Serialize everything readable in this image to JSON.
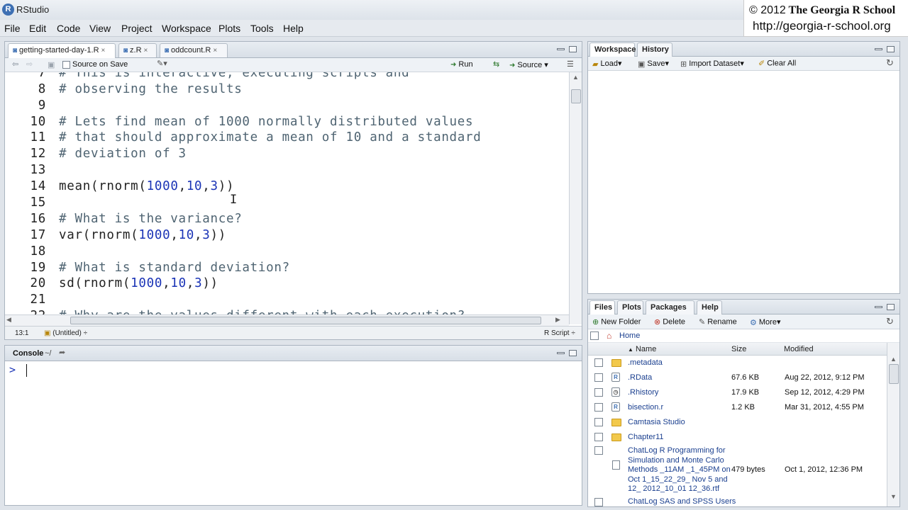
{
  "app": {
    "title": "RStudio",
    "icon_letter": "R"
  },
  "watermark": {
    "line1_copy": "© 2012",
    "line1_name": "The Georgia R School",
    "line2": "http://georgia-r-school.org"
  },
  "menu": [
    "File",
    "Edit",
    "Code",
    "View",
    "Project",
    "Workspace",
    "Plots",
    "Tools",
    "Help"
  ],
  "editor": {
    "tabs": [
      {
        "label": "getting-started-day-1.R",
        "close": "×"
      },
      {
        "label": "z.R",
        "close": "×"
      },
      {
        "label": "oddcount.R",
        "close": "×"
      }
    ],
    "toolbar": {
      "source_on_save": "Source on Save",
      "run": "Run",
      "source": "Source"
    },
    "lines": [
      {
        "n": "7",
        "text": "# This is interactive, executing scripts and"
      },
      {
        "n": "8",
        "text": "# observing the results"
      },
      {
        "n": "9",
        "text": ""
      },
      {
        "n": "10",
        "text": "# Lets find mean of 1000 normally distributed values"
      },
      {
        "n": "11",
        "text": "# that should approximate a mean of 10 and a standard"
      },
      {
        "n": "12",
        "text": "# deviation of 3"
      },
      {
        "n": "13",
        "text": ""
      },
      {
        "n": "14",
        "text": "mean(rnorm(1000,10,3))"
      },
      {
        "n": "15",
        "text": ""
      },
      {
        "n": "16",
        "text": "# What is the variance?"
      },
      {
        "n": "17",
        "text": "var(rnorm(1000,10,3))"
      },
      {
        "n": "18",
        "text": ""
      },
      {
        "n": "19",
        "text": "# What is standard deviation?"
      },
      {
        "n": "20",
        "text": "sd(rnorm(1000,10,3))"
      },
      {
        "n": "21",
        "text": ""
      },
      {
        "n": "22",
        "text": "# Why are the values different with each execution?"
      }
    ],
    "status": {
      "position": "13:1",
      "scope": "(Untitled)",
      "filetype": "R Script"
    }
  },
  "console": {
    "title": "Console",
    "path": "~/",
    "prompt": ">"
  },
  "workspace": {
    "tabs": [
      "Workspace",
      "History"
    ],
    "toolbar": {
      "load": "Load",
      "save": "Save",
      "import": "Import Dataset",
      "clear": "Clear All"
    }
  },
  "files": {
    "tabs": [
      "Files",
      "Plots",
      "Packages",
      "Help"
    ],
    "toolbar": {
      "new_folder": "New Folder",
      "delete": "Delete",
      "rename": "Rename",
      "more": "More"
    },
    "breadcrumb": "Home",
    "columns": {
      "name": "Name",
      "size": "Size",
      "modified": "Modified"
    },
    "rows": [
      {
        "icon": "folder",
        "name": ".metadata",
        "size": "",
        "modified": ""
      },
      {
        "icon": "rdata",
        "name": ".RData",
        "size": "67.6 KB",
        "modified": "Aug 22, 2012, 9:12 PM"
      },
      {
        "icon": "rhistory",
        "name": ".Rhistory",
        "size": "17.9 KB",
        "modified": "Sep 12, 2012, 4:29 PM"
      },
      {
        "icon": "rscript",
        "name": "bisection.r",
        "size": "1.2 KB",
        "modified": "Mar 31, 2012, 4:55 PM"
      },
      {
        "icon": "folder",
        "name": "Camtasia Studio",
        "size": "",
        "modified": ""
      },
      {
        "icon": "folder",
        "name": "Chapter11",
        "size": "",
        "modified": ""
      },
      {
        "icon": "document",
        "name_lines": [
          "ChatLog R Programming for",
          "Simulation and Monte Carlo",
          "Methods _11AM _1_45PM on",
          "Oct 1_15_22_29_ Nov 5 and",
          "12_ 2012_10_01 12_36.rtf"
        ],
        "size": "479 bytes",
        "modified": "Oct 1, 2012, 12:36 PM"
      },
      {
        "icon": "document",
        "name": "ChatLog SAS and SPSS Users",
        "size": "",
        "modified": ""
      }
    ]
  }
}
